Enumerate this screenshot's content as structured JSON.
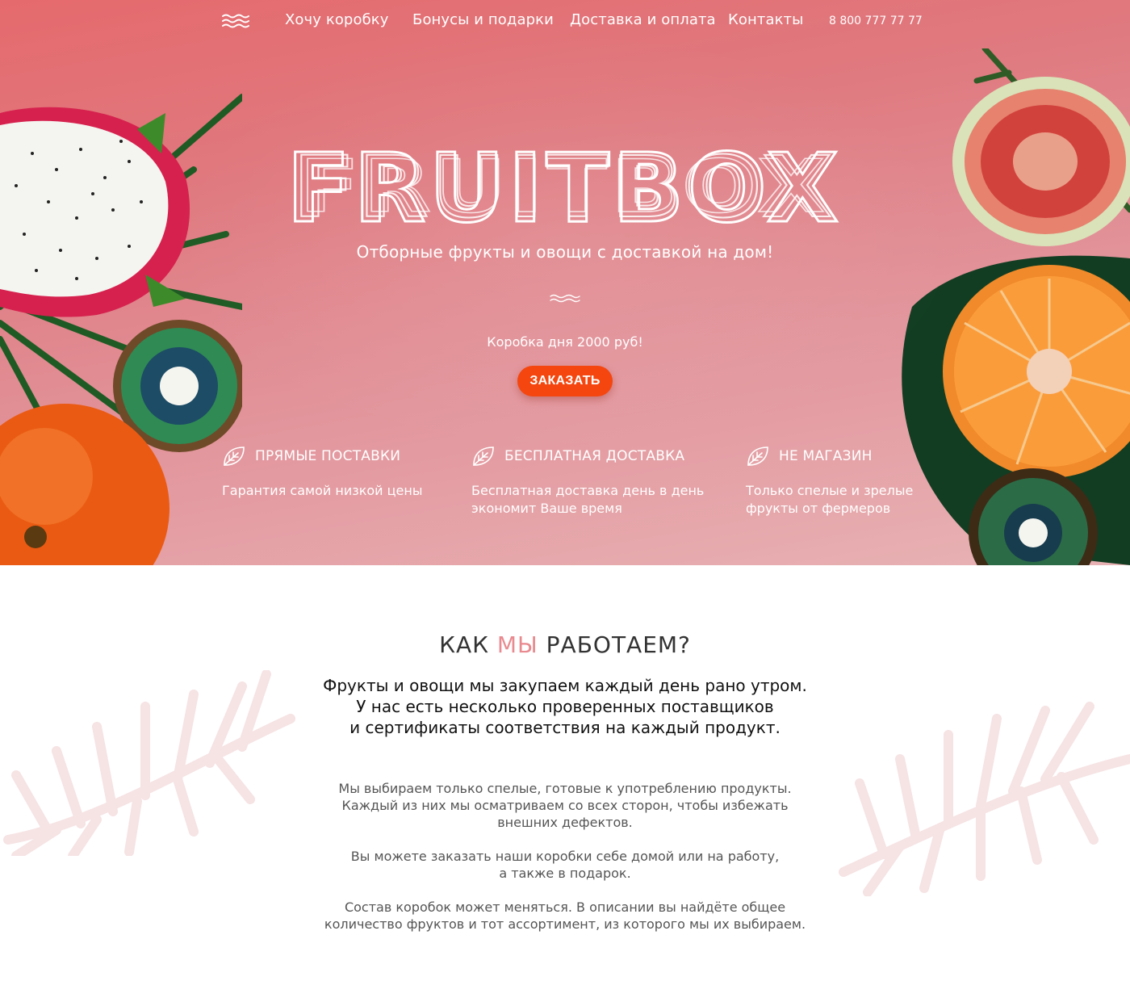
{
  "colors": {
    "hero_gradient_top": "#e56a6d",
    "hero_gradient_bottom": "#e8b3b5",
    "accent_button": "#f4460e",
    "title_accent": "#e88a8f",
    "leaf_watermark": "#f6e3e4"
  },
  "nav": {
    "logo_icon": "waves-icon",
    "items": [
      {
        "label": "Хочу коробку"
      },
      {
        "label": "Бонусы и подарки"
      },
      {
        "label": "Доставка и оплата"
      },
      {
        "label": "Контакты"
      }
    ],
    "phone": "8 800 777 77 77"
  },
  "hero": {
    "brand": "FRUITBOX",
    "tagline": "Отборные фрукты и овощи с доставкой на дом!",
    "divider_icon": "wave-line-icon",
    "box_price": "Коробка дня 2000 руб!",
    "order_button": "ЗАКАЗАТЬ",
    "features": [
      {
        "icon": "leaf-icon",
        "title": "ПРЯМЫЕ ПОСТАВКИ",
        "text": "Гарантия самой низкой цены"
      },
      {
        "icon": "leaf-icon",
        "title": "БЕСПЛАТНАЯ ДОСТАВКА",
        "text": "Бесплатная доставка день в день\nэкономит Ваше время"
      },
      {
        "icon": "leaf-icon",
        "title": "НЕ МАГАЗИН",
        "text": "Только спелые и зрелые\nфрукты от фермеров"
      }
    ]
  },
  "how": {
    "title_before": "КАК ",
    "title_accent": "МЫ",
    "title_after": " РАБОТАЕМ?",
    "lead": "Фрукты и овощи мы закупаем каждый день рано утром.\nУ нас есть несколько проверенных поставщиков\nи сертификаты соответствия на каждый продукт.",
    "paragraphs": [
      "Мы выбираем только спелые, готовые к употреблению продукты.\nКаждый из них мы осматриваем со всех сторон, чтобы избежать\nвнешних дефектов.",
      "Вы можете заказать наши коробки себе домой или на работу,\nа также в подарок.",
      "Состав коробок может меняться. В описании вы найдёте общее\nколичество фруктов и тот ассортимент, из которого мы их выбираем."
    ]
  }
}
